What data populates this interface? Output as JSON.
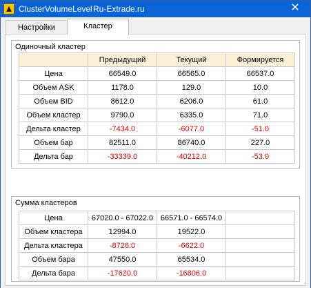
{
  "window": {
    "title": "ClusterVolumeLevel",
    "subtitle": "Ru-Extrade.ru",
    "close_glyph": "✕"
  },
  "tabs": [
    {
      "label": "Настройки",
      "active": false
    },
    {
      "label": "Кластер",
      "active": true
    }
  ],
  "single_cluster": {
    "title": "Одиночный кластер",
    "columns": [
      "",
      "Предыдущий",
      "Текущий",
      "Формируется"
    ],
    "rows": [
      {
        "label": "Цена",
        "values": [
          "66549.0",
          "66565.0",
          "66537.0"
        ],
        "negative": [
          false,
          false,
          false
        ]
      },
      {
        "label": "Объем ASK",
        "values": [
          "1178.0",
          "129.0",
          "10.0"
        ],
        "negative": [
          false,
          false,
          false
        ]
      },
      {
        "label": "Объем BID",
        "values": [
          "8612.0",
          "6206.0",
          "61.0"
        ],
        "negative": [
          false,
          false,
          false
        ]
      },
      {
        "label": "Объем кластер",
        "values": [
          "9790.0",
          "6335.0",
          "71.0"
        ],
        "negative": [
          false,
          false,
          false
        ]
      },
      {
        "label": "Дельта кластер",
        "values": [
          "-7434.0",
          "-6077.0",
          "-51.0"
        ],
        "negative": [
          true,
          true,
          true
        ]
      },
      {
        "label": "Объем бар",
        "values": [
          "82511.0",
          "86740.0",
          "227.0"
        ],
        "negative": [
          false,
          false,
          false
        ]
      },
      {
        "label": "Дельта бар",
        "values": [
          "-33339.0",
          "-40212.0",
          "-53.0"
        ],
        "negative": [
          true,
          true,
          true
        ]
      }
    ]
  },
  "sum_clusters": {
    "title": "Сумма кластеров",
    "rows": [
      {
        "label": "Цена",
        "values": [
          "67020.0 - 67022.0",
          "66571.0 - 66574.0",
          ""
        ],
        "negative": [
          false,
          false,
          false
        ]
      },
      {
        "label": "Объем кластера",
        "values": [
          "12994.0",
          "19522.0",
          ""
        ],
        "negative": [
          false,
          false,
          false
        ]
      },
      {
        "label": "Дельта кластера",
        "values": [
          "-8726.0",
          "-6622.0",
          ""
        ],
        "negative": [
          true,
          true,
          false
        ]
      },
      {
        "label": "Объем бара",
        "values": [
          "47550.0",
          "65534.0",
          ""
        ],
        "negative": [
          false,
          false,
          false
        ]
      },
      {
        "label": "Дельта бара",
        "values": [
          "-17620.0",
          "-16806.0",
          ""
        ],
        "negative": [
          true,
          true,
          false
        ]
      }
    ]
  },
  "colors": {
    "titlebar": "#0a64d6",
    "negative": "#e00000",
    "header_bg": "#fdf0d8"
  }
}
